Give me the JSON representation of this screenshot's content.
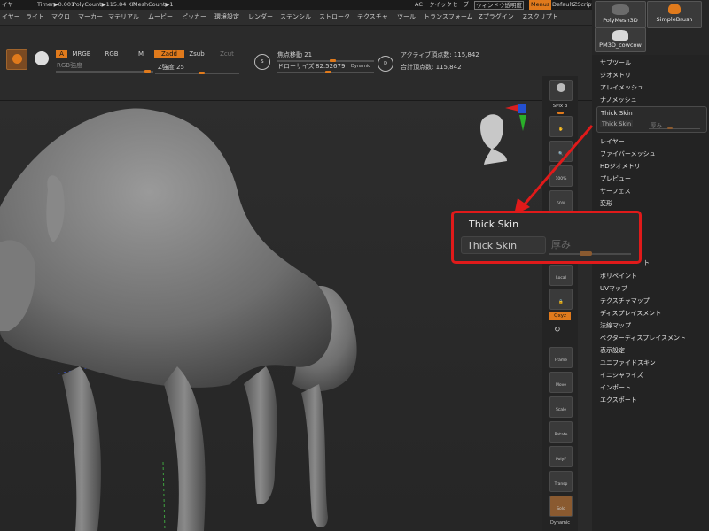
{
  "statusbar": {
    "menu_fragment": "イヤー",
    "timer": "Timer▶0.001",
    "polycount": "PolyCount▶115.84 KP",
    "meshcount": "MeshCount▶1",
    "ac": "AC",
    "quicksave": "クイックセーブ",
    "window_transparency": "ウィンドウ透明度",
    "menus": "Menus",
    "default_script": "DefaultZScript"
  },
  "menubar": [
    "イヤー",
    "ライト",
    "マクロ",
    "マーカー",
    "マテリアル",
    "ムービー",
    "ピッカー",
    "環境設定",
    "レンダー",
    "ステンシル",
    "ストローク",
    "テクスチャ",
    "ツール",
    "トランスフォーム",
    "Zプラグイン",
    "Zスクリプト"
  ],
  "brushes": {
    "polymesh": "PolyMesh3D",
    "simplebrush": "SimpleBrush",
    "pm3d": "PM3D_cowcow"
  },
  "toolbar": {
    "a": "A",
    "mrgb": "MRGB",
    "rgb": "RGB",
    "m": "M",
    "zadd": "Zadd",
    "zsub": "Zsub",
    "zcut": "Zcut",
    "rgb_intensity": "RGB強度",
    "z_intensity": "Z強度 25",
    "focal_shift": "焦点移動 21",
    "draw_size": "ドローサイズ",
    "draw_size_value": "82.52679",
    "dynamic": "Dynamic",
    "active_points": "アクティブ頂点数: 115,842",
    "total_points": "合計頂点数: 115,842",
    "s_label": "S",
    "d_label": "D"
  },
  "shelf": {
    "spix_label": "SPix 3",
    "persp": "Persp",
    "floor": "Floor",
    "local": "Local",
    "xyz": "Qxyz",
    "frame": "Frame",
    "move": "Move",
    "scale": "Scale",
    "rotate": "Rotate",
    "polyf": "PolyF",
    "transp": "Transp",
    "solo": "Solo",
    "dynamic": "Dynamic"
  },
  "palette": {
    "items_top": [
      "サブツール",
      "ジオメトリ",
      "アレイメッシュ",
      "ナノメッシュ"
    ],
    "thick_skin_header": "Thick Skin",
    "thick_skin_button": "Thick Skin",
    "thickness_label": "厚み",
    "items_mid": [
      "レイヤー",
      "ファイバーメッシュ",
      "HDジオメトリ",
      "プレビュー",
      "サーフェス",
      "変形"
    ],
    "items_partial": "ト",
    "items_bottom": [
      "ポリペイント",
      "UVマップ",
      "テクスチャマップ",
      "ディスプレイスメント",
      "法線マップ",
      "ベクターディスプレイスメント",
      "表示設定",
      "ユニファイドスキン",
      "イニシャライズ",
      "インポート",
      "エクスポート"
    ]
  },
  "popup": {
    "header": "Thick Skin",
    "button": "Thick Skin",
    "slider_label": "厚み",
    "slider_value": 0.5
  },
  "colors": {
    "accent": "#e07a1c",
    "highlight_red": "#e01a1a",
    "bg": "#2a2a2a"
  }
}
